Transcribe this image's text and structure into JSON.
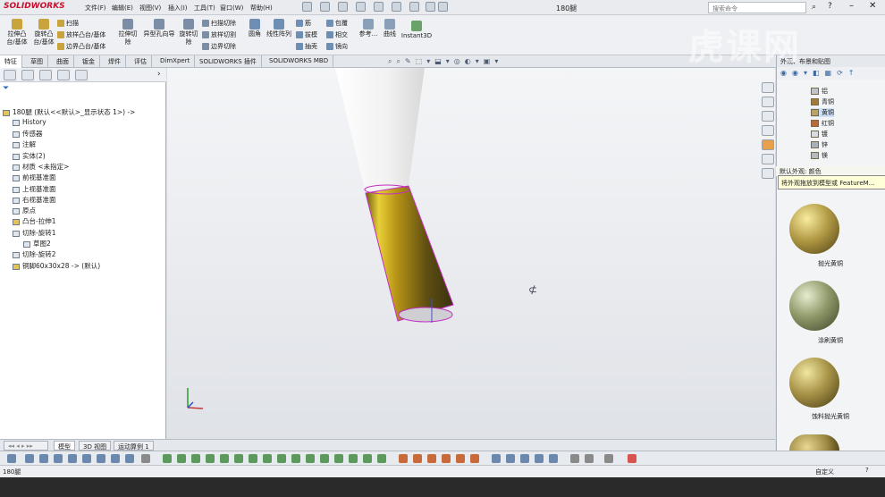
{
  "app": {
    "name": "SOLIDWORKS",
    "doc_title": "180腿",
    "search_placeholder": "搜索命令"
  },
  "menus": [
    "文件(F)",
    "编辑(E)",
    "视图(V)",
    "插入(I)",
    "工具(T)",
    "窗口(W)",
    "帮助(H)"
  ],
  "ribbon": {
    "extrude_boss": "拉伸凸\n台/基体",
    "revolve_boss": "旋转凸\n台/基体",
    "sweep": "扫描",
    "loft_boss": "放样凸台/基体",
    "boundary_boss": "边界凸台/基体",
    "extrude_cut": "拉伸切\n除",
    "hole_wizard": "异型孔向导",
    "revolve_cut": "旋转切\n除",
    "sweep_cut": "扫描切除",
    "loft_cut": "放样切割",
    "boundary_cut": "边界切除",
    "fillet": "圆角",
    "linear_pattern": "线性阵列",
    "rib": "筋",
    "draft": "拔模",
    "shell": "抽壳",
    "wrap": "包覆",
    "intersect": "相交",
    "mirror": "镜向",
    "ref_geometry": "参考...",
    "curves": "曲线",
    "instant3d": "Instant3D"
  },
  "tabs": [
    "特征",
    "草图",
    "曲面",
    "钣金",
    "焊件",
    "评估",
    "DimXpert",
    "SOLIDWORKS 插件",
    "SOLIDWORKS MBD"
  ],
  "tree": {
    "root": "180腿 (默认<<默认>_显示状态 1>) ->",
    "items": [
      "History",
      "传感器",
      "注解",
      "实体(2)",
      "材质 <未指定>",
      "前视基准面",
      "上视基准面",
      "右视基准面",
      "原点",
      "凸台-拉伸1",
      "切除-旋转1",
      "草图2",
      "切除-旋转2",
      "铜脚60x30x28 -> (默认)"
    ]
  },
  "right_panel": {
    "title": "外观、布景和贴图",
    "appearances": [
      "铝",
      "青铜",
      "黄铜",
      "红铜",
      "镀",
      "锌",
      "镁"
    ],
    "tip_head": "默认外观: 颜色",
    "tooltip": "将外观拖放到模型或 FeatureM...",
    "swatches": [
      {
        "label": "抛光黄铜",
        "color": "#b29a45"
      },
      {
        "label": "涂刷黄铜",
        "color": "#8f9a6a"
      },
      {
        "label": "蚀料抛光黄铜",
        "color": "#a89448"
      }
    ]
  },
  "bottom_tabs": [
    "模型",
    "3D 视图",
    "运动算例 1"
  ],
  "status": {
    "left": "180腿",
    "right": "自定义"
  },
  "watermark": "虎课网"
}
